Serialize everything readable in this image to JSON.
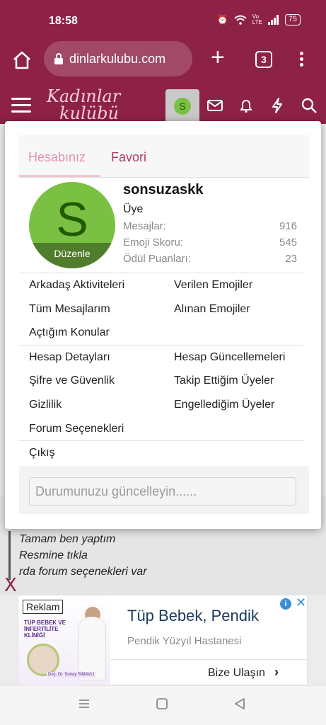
{
  "status_bar": {
    "time": "18:58",
    "network_label": "Vo LTE",
    "battery": "75"
  },
  "browser": {
    "url": "dinlarkulubu.com",
    "tabs_count": "3"
  },
  "site": {
    "logo_line1": "Kadınlar",
    "logo_line2": "kulübü",
    "avatar_letter": "S"
  },
  "popup": {
    "tabs": [
      "Hesabınız",
      "Favori"
    ],
    "profile": {
      "avatar_letter": "S",
      "edit_label": "Düzenle",
      "username": "sonsuzaskk",
      "role": "Üye",
      "stats": [
        {
          "label": "Mesajlar:",
          "value": "916"
        },
        {
          "label": "Emoji Skoru:",
          "value": "545"
        },
        {
          "label": "Ödül Puanları:",
          "value": "23"
        }
      ]
    },
    "links_group1": {
      "left": [
        "Arkadaş Aktiviteleri",
        "Tüm Mesajlarım",
        "Açtığım Konular"
      ],
      "right": [
        "Verilen Emojiler",
        "Alınan Emojiler"
      ]
    },
    "links_group2": {
      "left": [
        "Hesap Detayları",
        "Şifre ve Güvenlik",
        "Gizlilik",
        "Forum Seçenekleri"
      ],
      "right": [
        "Hesap Güncellemeleri",
        "Takip Ettiğim Üyeler",
        "Engellediğim Üyeler"
      ]
    },
    "logout": "Çıkış",
    "status_placeholder": "Durumunuzu güncelleyin......"
  },
  "background": {
    "quote_lines": [
      "Tamam ben yaptım",
      "Resmine tıkla",
      "rda forum seçenekleri var"
    ],
    "close_x": "X"
  },
  "ad": {
    "label": "Reklam",
    "image_text": "TÜP BEBEK VE İNFERTİLİTE KLİNİĞİ",
    "image_caption": "Doç. Dr. Sonay SİMAVLI",
    "title": "Tüp Bebek, Pendik",
    "subtitle": "Pendik Yüzyıl Hastanesi",
    "cta": "Bize Ulaşın"
  }
}
